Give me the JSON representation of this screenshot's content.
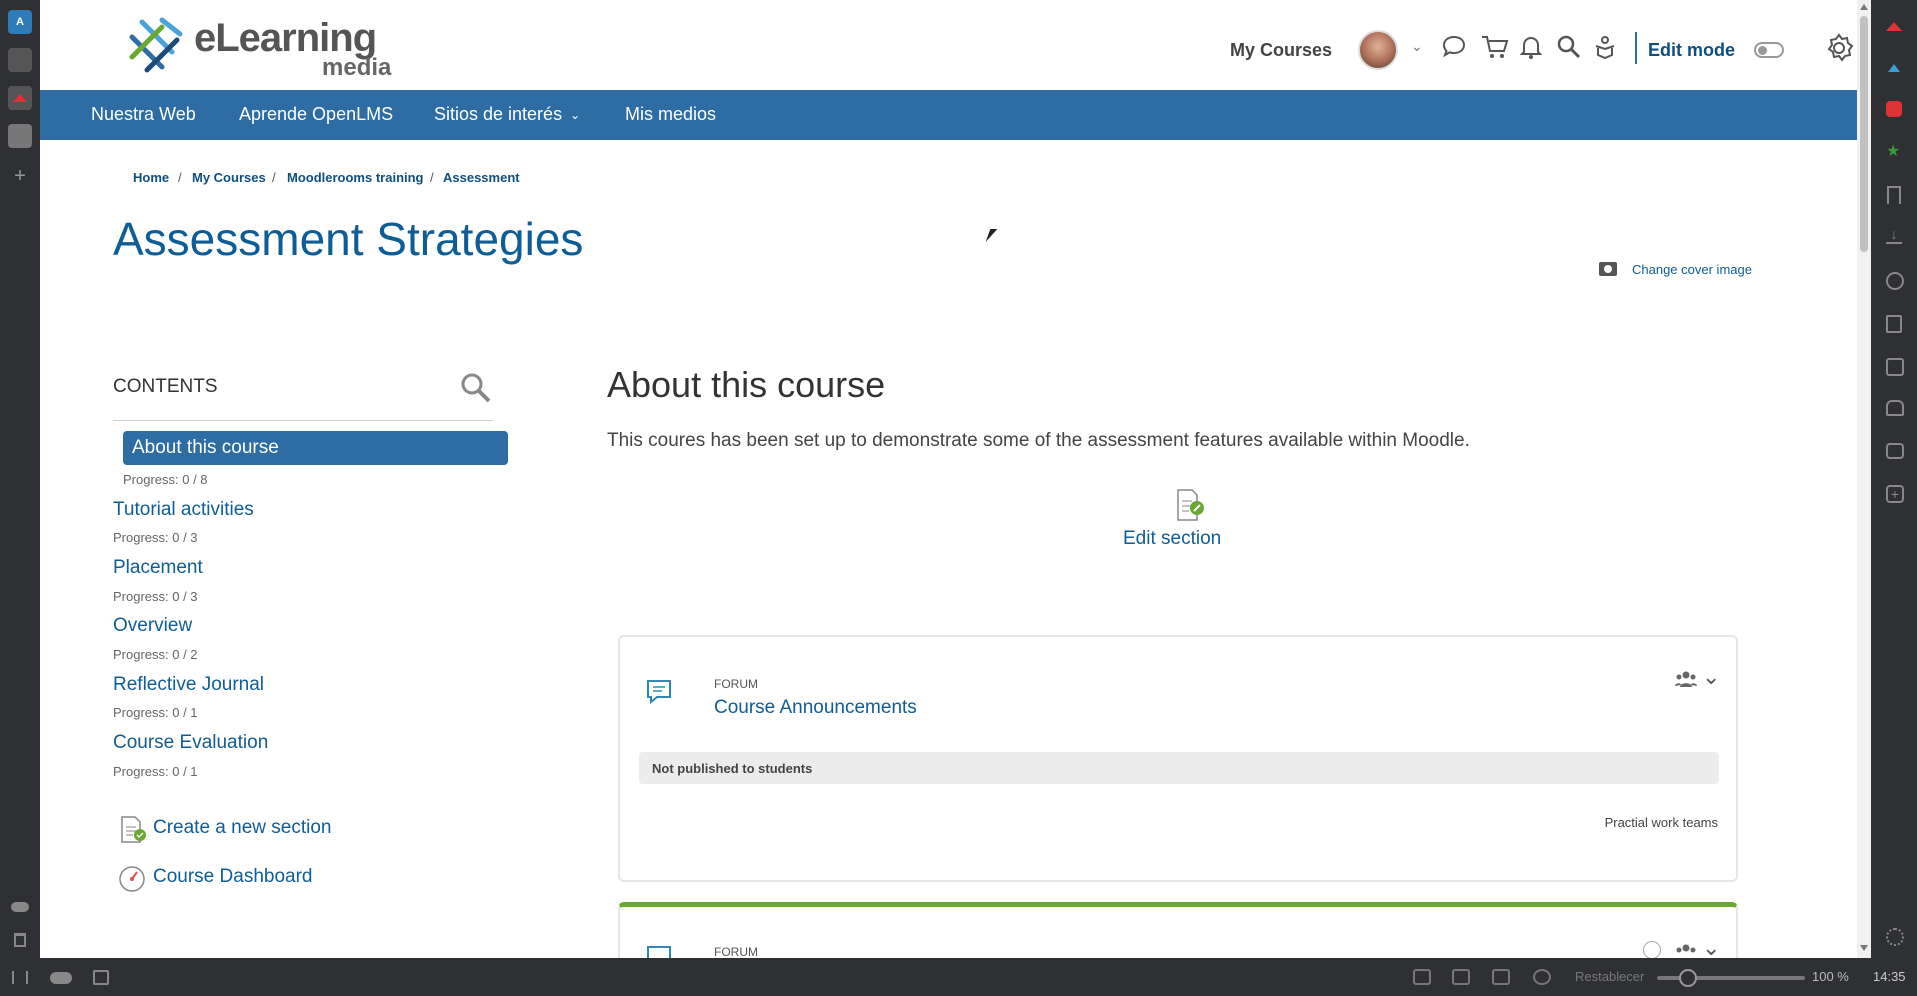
{
  "header": {
    "logo_main": "eLearning",
    "logo_sub": "media",
    "my_courses": "My Courses",
    "edit_mode": "Edit mode"
  },
  "nav": [
    {
      "label": "Nuestra Web"
    },
    {
      "label": "Aprende OpenLMS"
    },
    {
      "label": "Sitios de interés"
    },
    {
      "label": "Mis medios"
    }
  ],
  "breadcrumb": [
    "Home",
    "My Courses",
    "Moodlerooms training",
    "Assessment"
  ],
  "page": {
    "title": "Assessment Strategies",
    "change_cover": "Change cover image"
  },
  "contents": {
    "heading": "CONTENTS",
    "items": [
      {
        "label": "About this course",
        "progress": "Progress: 0 / 8"
      },
      {
        "label": "Tutorial activities",
        "progress": "Progress: 0 / 3"
      },
      {
        "label": "Placement",
        "progress": "Progress: 0 / 3"
      },
      {
        "label": "Overview",
        "progress": "Progress: 0 / 2"
      },
      {
        "label": "Reflective Journal",
        "progress": "Progress: 0 / 1"
      },
      {
        "label": "Course Evaluation",
        "progress": "Progress: 0 / 1"
      }
    ],
    "create_section": "Create a new section",
    "dashboard": "Course Dashboard"
  },
  "section": {
    "title": "About this course",
    "description": "This coures has been set up to demonstrate some of the assessment features available within Moodle.",
    "edit_section": "Edit section"
  },
  "activities": [
    {
      "type": "FORUM",
      "name": "Course Announcements",
      "restriction": "Not published to students",
      "grouping": "Practial work teams"
    },
    {
      "type": "FORUM"
    }
  ],
  "statusbar": {
    "reset": "Restablecer",
    "zoom": "100 %",
    "time": "14:35"
  },
  "colors": {
    "nav_bg": "#2d6da3",
    "link": "#0f5d96",
    "title": "#0f5d96",
    "active_item": "#2d6da3",
    "complete_bar": "#6aa832"
  }
}
